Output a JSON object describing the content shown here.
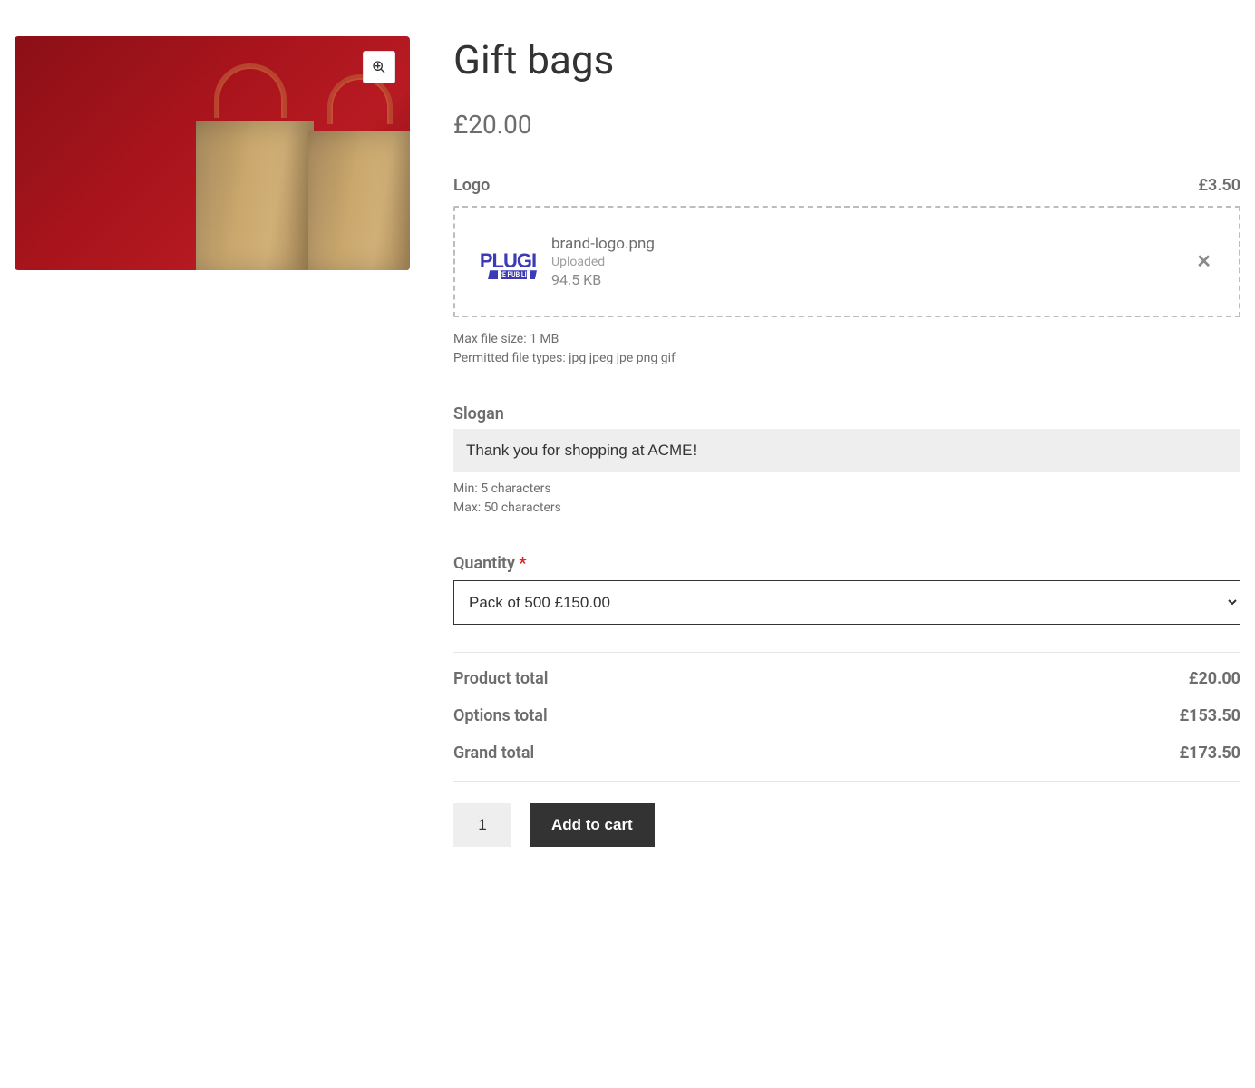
{
  "product": {
    "title": "Gift bags",
    "base_price": "£20.00"
  },
  "logo_option": {
    "label": "Logo",
    "price": "£3.50",
    "file": {
      "name": "brand-logo.png",
      "status": "Uploaded",
      "size": "94.5 KB",
      "thumb_text": "PLUGI",
      "thumb_banner": "RE PUB LI"
    },
    "hint_max": "Max file size: 1 MB",
    "hint_types": "Permitted file types: jpg jpeg jpe png gif"
  },
  "slogan_option": {
    "label": "Slogan",
    "value": "Thank you for shopping at ACME!",
    "hint_min": "Min: 5 characters",
    "hint_max": "Max: 50 characters"
  },
  "quantity_option": {
    "label": "Quantity",
    "required": "*",
    "selected": "Pack of 500 £150.00"
  },
  "totals": {
    "product_label": "Product total",
    "product_value": "£20.00",
    "options_label": "Options total",
    "options_value": "£153.50",
    "grand_label": "Grand total",
    "grand_value": "£173.50"
  },
  "cart": {
    "qty": "1",
    "button": "Add to cart"
  }
}
